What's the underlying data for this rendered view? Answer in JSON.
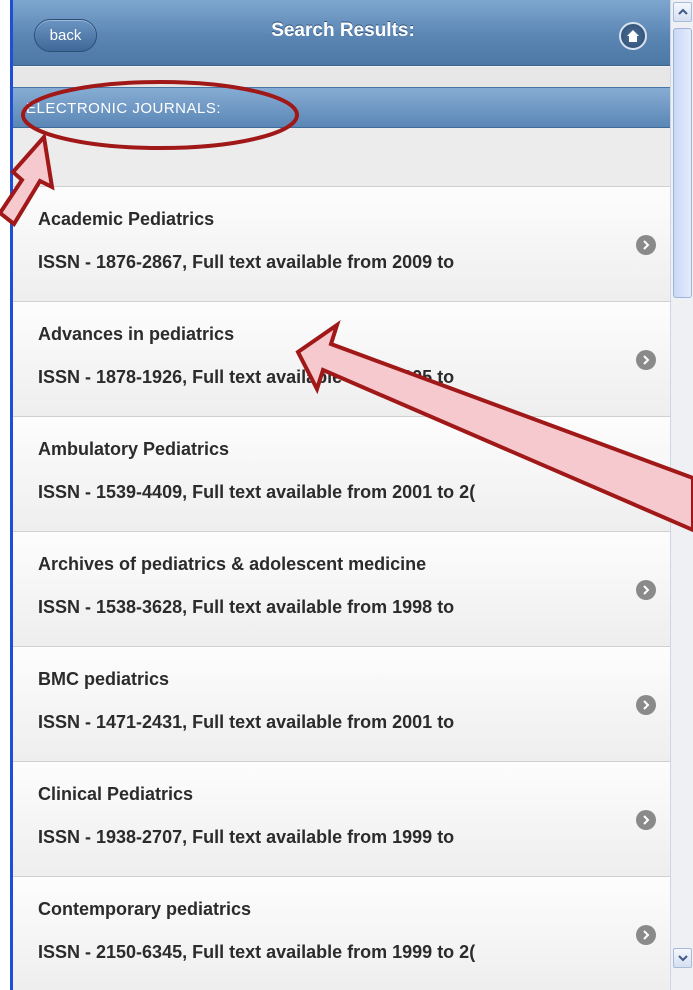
{
  "header": {
    "back_label": "back",
    "title": "Search Results:"
  },
  "divider": {
    "label": "ELECTRONIC JOURNALS:"
  },
  "items": [
    {
      "title": "Academic Pediatrics",
      "detail": "ISSN - 1876-2867, Full text available from 2009 to"
    },
    {
      "title": "Advances in pediatrics",
      "detail": "ISSN - 1878-1926, Full text available from 2005 to"
    },
    {
      "title": "Ambulatory Pediatrics",
      "detail": "ISSN - 1539-4409, Full text available from 2001 to 2("
    },
    {
      "title": "Archives of pediatrics & adolescent medicine",
      "detail": "ISSN - 1538-3628, Full text available from 1998 to"
    },
    {
      "title": "BMC pediatrics",
      "detail": "ISSN - 1471-2431, Full text available from 2001 to"
    },
    {
      "title": "Clinical Pediatrics",
      "detail": "ISSN - 1938-2707, Full text available from 1999 to"
    },
    {
      "title": "Contemporary pediatrics",
      "detail": "ISSN - 2150-6345, Full text available from 1999 to 2("
    }
  ],
  "icons": {
    "home": "home-icon",
    "chevron": "chevron-right-icon",
    "scroll_up": "scroll-up-icon",
    "scroll_down": "scroll-down-icon"
  },
  "colors": {
    "header": "#5b86b4",
    "divider": "#6f97c2",
    "annotation_red": "#a01818",
    "annotation_fill": "#f6c9cf",
    "left_edge": "#1f4fd6"
  }
}
